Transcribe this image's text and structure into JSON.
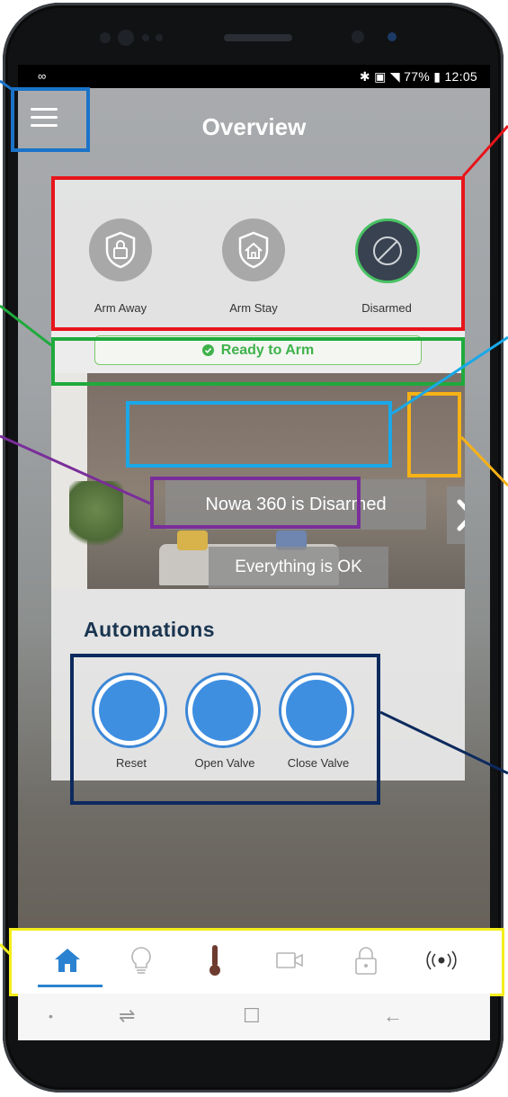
{
  "status_bar": {
    "left_icon": "∞",
    "right_text": "77% ▮ 12:05",
    "battery": "77%",
    "time": "12:05"
  },
  "header": {
    "title": "Overview",
    "menu_icon": "hamburger-menu-icon"
  },
  "arm_modes": [
    {
      "label": "Arm Away",
      "icon": "shield-lock-icon",
      "active": false
    },
    {
      "label": "Arm Stay",
      "icon": "shield-home-icon",
      "active": false
    },
    {
      "label": "Disarmed",
      "icon": "disarmed-slash-icon",
      "active": true
    }
  ],
  "ready": {
    "text": "Ready to Arm",
    "color": "#3fb24b"
  },
  "hero": {
    "status": "Nowa 360 is Disarmed",
    "message": "Everything is OK",
    "next_icon": "chevron-right-icon"
  },
  "automations": {
    "title": "Automations",
    "items": [
      {
        "label": "Reset"
      },
      {
        "label": "Open Valve"
      },
      {
        "label": "Close Valve"
      }
    ],
    "button_color": "#3f8fe1"
  },
  "tabs": [
    {
      "name": "home",
      "icon": "home-icon",
      "active": true
    },
    {
      "name": "lights",
      "icon": "lightbulb-icon",
      "active": false
    },
    {
      "name": "thermostat",
      "icon": "thermometer-icon",
      "active": false
    },
    {
      "name": "camera",
      "icon": "video-camera-icon",
      "active": false
    },
    {
      "name": "locks",
      "icon": "padlock-icon",
      "active": false
    },
    {
      "name": "sensors",
      "icon": "signal-icon",
      "active": false
    }
  ],
  "nav_keys": [
    "•",
    "⇌",
    "☐",
    "←"
  ],
  "annotation_colors": {
    "menu": "#1a73c8",
    "arm_panel": "#e8141b",
    "ready": "#1faa3c",
    "status": "#1aa8e8",
    "next": "#f7b215",
    "ok": "#7a2e9a",
    "automations": "#0d2a5e",
    "tabbar": "#f3ee1a"
  },
  "accent": "#2b82d0"
}
